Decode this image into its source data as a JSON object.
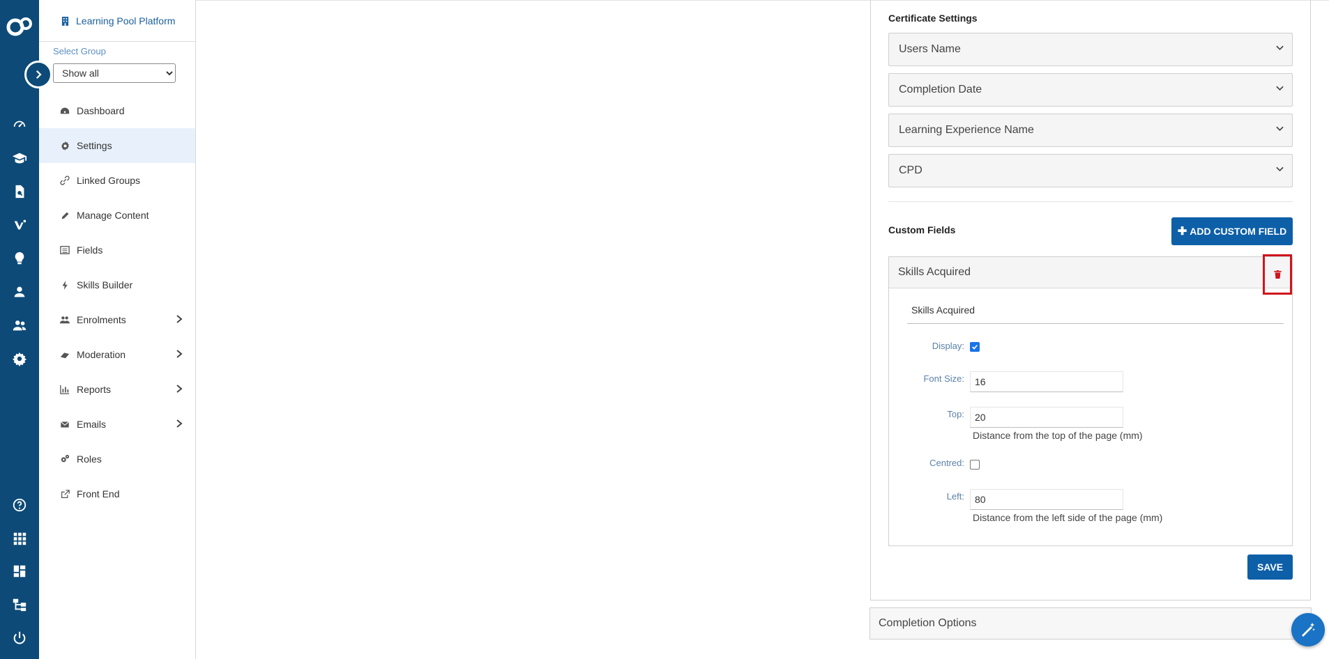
{
  "nav": {
    "brand": "Learning Pool Platform",
    "select_group_label": "Select Group",
    "select_group_value": "Show all",
    "items": [
      {
        "label": "Dashboard",
        "icon": "dashboard-icon"
      },
      {
        "label": "Settings",
        "icon": "gear-icon",
        "active": true
      },
      {
        "label": "Linked Groups",
        "icon": "link-icon"
      },
      {
        "label": "Manage Content",
        "icon": "pencil-icon"
      },
      {
        "label": "Fields",
        "icon": "list-icon"
      },
      {
        "label": "Skills Builder",
        "icon": "bolt-icon"
      },
      {
        "label": "Enrolments",
        "icon": "users-icon",
        "has_submenu": true
      },
      {
        "label": "Moderation",
        "icon": "eraser-icon",
        "has_submenu": true
      },
      {
        "label": "Reports",
        "icon": "bar-chart-icon",
        "has_submenu": true
      },
      {
        "label": "Emails",
        "icon": "envelope-icon",
        "has_submenu": true
      },
      {
        "label": "Roles",
        "icon": "cogs-icon"
      },
      {
        "label": "Front End",
        "icon": "external-link-icon"
      }
    ]
  },
  "certificate": {
    "title": "Certificate Settings",
    "dropdowns": [
      "Users Name",
      "Completion Date",
      "Learning Experience Name",
      "CPD"
    ]
  },
  "custom_fields": {
    "title": "Custom Fields",
    "add_button": "ADD CUSTOM FIELD",
    "field": {
      "header": "Skills Acquired",
      "name_value": "Skills Acquired",
      "display_label": "Display:",
      "display_checked": true,
      "font_size_label": "Font Size:",
      "font_size_value": "16",
      "top_label": "Top:",
      "top_value": "20",
      "top_help": "Distance from the top of the page (mm)",
      "centred_label": "Centred:",
      "centred_checked": false,
      "left_label": "Left:",
      "left_value": "80",
      "left_help": "Distance from the left side of the page (mm)"
    },
    "save_button": "SAVE"
  },
  "completion_options": "Completion Options",
  "colors": {
    "rail": "#0d4a78",
    "primary": "#0d5fa8",
    "highlight": "#d0141c",
    "active_nav": "#e8f1fb"
  }
}
